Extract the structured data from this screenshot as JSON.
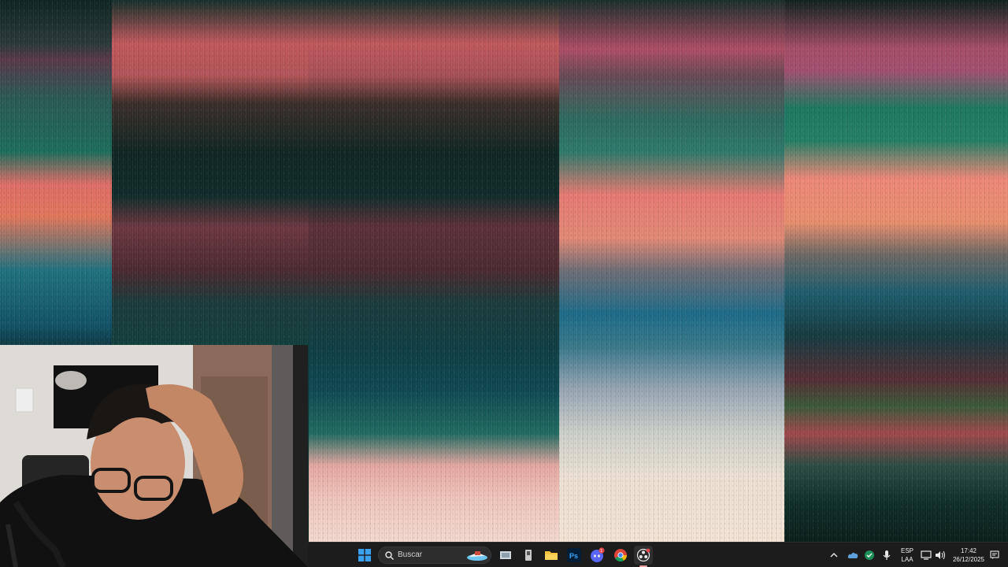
{
  "taskbar": {
    "search_placeholder": "Buscar",
    "language_line1": "ESP",
    "language_line2": "LAA",
    "time": "17:42",
    "date": "26/12/2025",
    "discord_badge": "1"
  },
  "colors": {
    "taskbar_bg": "#1c1c1c",
    "start_blue": "#3aa0f0",
    "discord": "#5865f2",
    "photoshop": "#001e36",
    "folder": "#f3c33c"
  },
  "icons": [
    "windows-start-icon",
    "search-icon",
    "task-view-icon",
    "file-explorer-icon",
    "photoshop-icon",
    "discord-icon",
    "chrome-icon",
    "obs-icon",
    "chevron-up-icon",
    "onedrive-icon",
    "security-icon",
    "microphone-icon",
    "network-icon",
    "volume-icon",
    "notification-icon"
  ]
}
